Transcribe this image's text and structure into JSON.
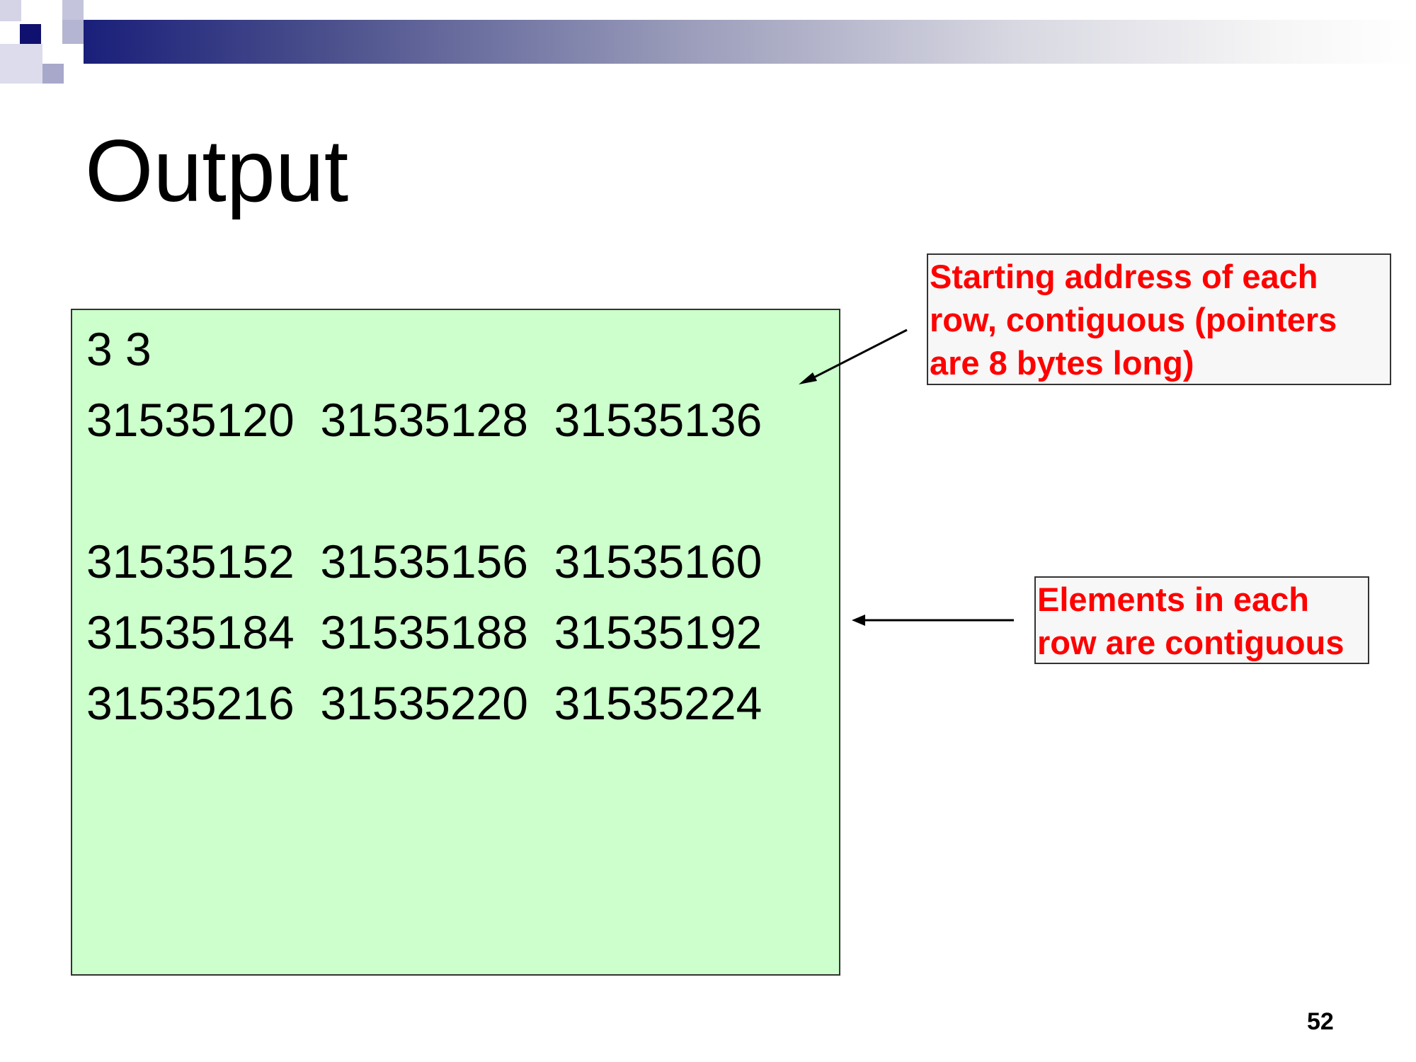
{
  "slide": {
    "title": "Output",
    "page_number": "52"
  },
  "output": {
    "lines": [
      "3 3",
      "31535120  31535128  31535136",
      "31535152  31535156  31535160",
      "31535184  31535188  31535192",
      "31535216  31535220  31535224"
    ]
  },
  "callouts": {
    "row_pointers": "Starting address of each\nrow, contiguous (pointers\nare 8 bytes long)",
    "row_elements": "Elements in each\nrow are contiguous"
  },
  "colors": {
    "output_background": "#ccffcc",
    "callout_text": "#ff0000",
    "header_gradient_start": "#1a1f7a"
  }
}
